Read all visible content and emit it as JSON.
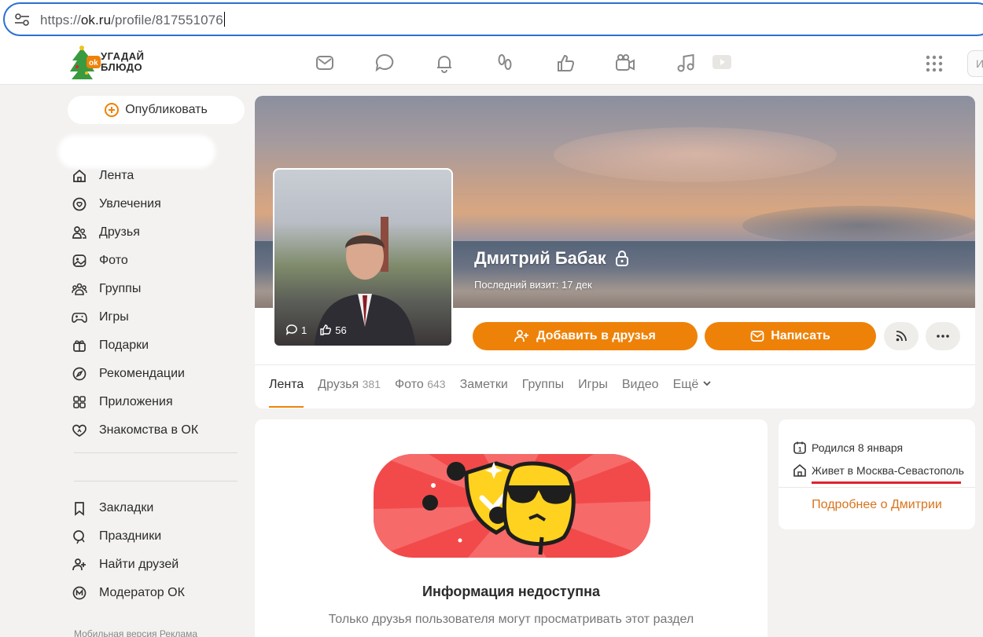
{
  "browser": {
    "url_prefix": "https://",
    "url_host": "ok.ru",
    "url_path": "/profile/817551076"
  },
  "header": {
    "logo_line1": "УГАДАЙ",
    "logo_line2": "БЛЮДО",
    "more_label": "И"
  },
  "sidebar": {
    "publish_label": "Опубликовать",
    "items": [
      {
        "label": "Лента",
        "icon": "home-icon"
      },
      {
        "label": "Увлечения",
        "icon": "hobby-icon"
      },
      {
        "label": "Друзья",
        "icon": "friends-icon"
      },
      {
        "label": "Фото",
        "icon": "photo-icon"
      },
      {
        "label": "Группы",
        "icon": "groups-icon"
      },
      {
        "label": "Игры",
        "icon": "gamepad-icon"
      },
      {
        "label": "Подарки",
        "icon": "gift-icon"
      },
      {
        "label": "Рекомендации",
        "icon": "compass-icon"
      },
      {
        "label": "Приложения",
        "icon": "apps-icon"
      },
      {
        "label": "Знакомства в ОК",
        "icon": "dating-icon"
      }
    ],
    "items2": [
      {
        "label": "Закладки",
        "icon": "bookmark-icon"
      },
      {
        "label": "Праздники",
        "icon": "holiday-icon"
      },
      {
        "label": "Найти друзей",
        "icon": "add-friend-icon"
      },
      {
        "label": "Модератор ОК",
        "icon": "moderator-icon"
      }
    ],
    "footer": "Мобильная версия   Реклама"
  },
  "profile": {
    "name": "Дмитрий Бабак",
    "last_visit": "Последний визит: 17 дек",
    "avatar_comments": "1",
    "avatar_likes": "56",
    "add_friend_label": "Добавить в друзья",
    "message_label": "Написать",
    "tabs": [
      {
        "label": "Лента",
        "count": ""
      },
      {
        "label": "Друзья",
        "count": "381"
      },
      {
        "label": "Фото",
        "count": "643"
      },
      {
        "label": "Заметки",
        "count": ""
      },
      {
        "label": "Группы",
        "count": ""
      },
      {
        "label": "Игры",
        "count": ""
      },
      {
        "label": "Видео",
        "count": ""
      },
      {
        "label": "Ещё",
        "count": ""
      }
    ]
  },
  "content": {
    "title": "Информация недоступна",
    "subtitle": "Только друзья пользователя могут просматривать этот раздел"
  },
  "info": {
    "birthday": "Родился 8 января",
    "lives": "Живет в Москва-Севастополь",
    "more_link": "Подробнее о Дмитрии"
  },
  "colors": {
    "accent": "#ee8208",
    "underline": "#e0232f",
    "link": "#d9731c"
  }
}
